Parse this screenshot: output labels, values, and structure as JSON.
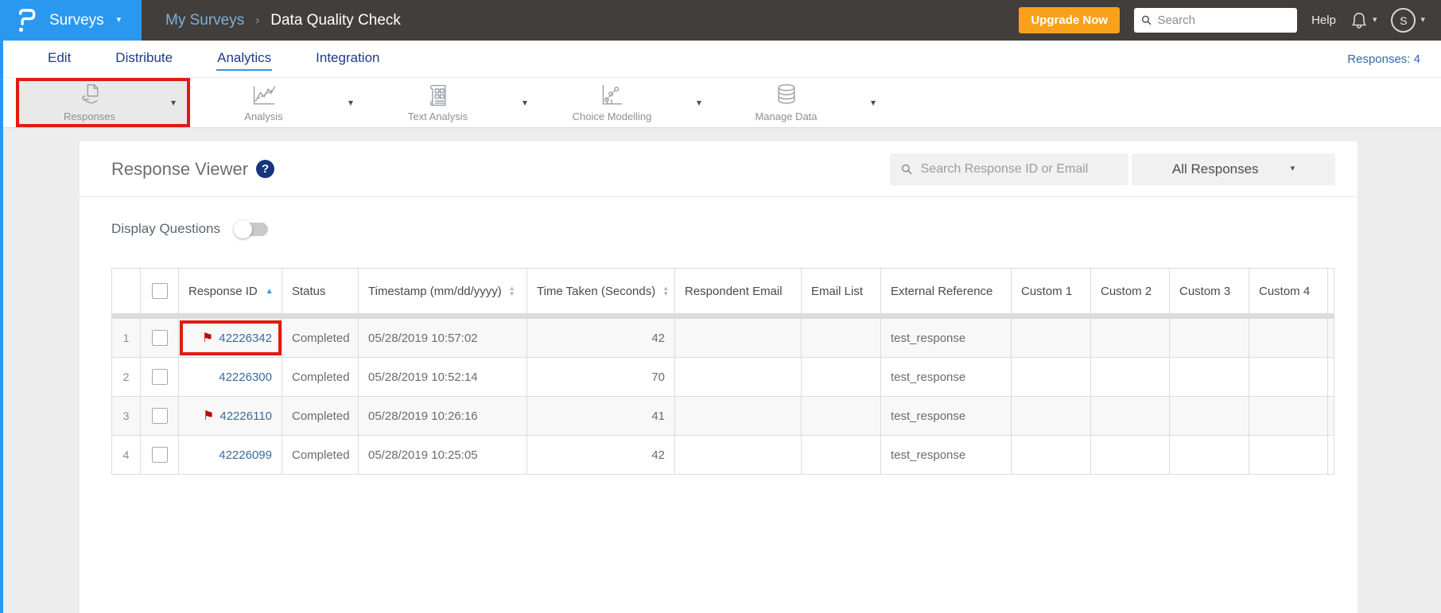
{
  "topbar": {
    "product": "Surveys",
    "breadcrumb": {
      "parent": "My Surveys",
      "separator": "›",
      "current": "Data Quality Check"
    },
    "upgrade_label": "Upgrade Now",
    "search_placeholder": "Search",
    "help_label": "Help",
    "avatar_initial": "S"
  },
  "nav": {
    "tabs": [
      "Edit",
      "Distribute",
      "Analytics",
      "Integration"
    ],
    "active_tab": "Analytics",
    "responses_count_label": "Responses: 4"
  },
  "toolbar": {
    "items": [
      {
        "label": "Responses",
        "icon": "hand-document-icon",
        "selected": true,
        "annotated": true
      },
      {
        "label": "Analysis",
        "icon": "line-chart-icon",
        "selected": false,
        "annotated": false
      },
      {
        "label": "Text Analysis",
        "icon": "newspaper-icon",
        "selected": false,
        "annotated": false
      },
      {
        "label": "Choice Modelling",
        "icon": "scatter-chart-icon",
        "selected": false,
        "annotated": false
      },
      {
        "label": "Manage Data",
        "icon": "database-icon",
        "selected": false,
        "annotated": false
      }
    ]
  },
  "panel": {
    "title": "Response Viewer",
    "help_glyph": "?",
    "search_placeholder": "Search Response ID or Email",
    "filter_value": "All Responses",
    "display_questions_label": "Display Questions",
    "display_questions_state": "off"
  },
  "table": {
    "columns": [
      {
        "label": "",
        "type": "row-number"
      },
      {
        "label": "",
        "type": "checkbox"
      },
      {
        "label": "Response ID",
        "sort": "asc"
      },
      {
        "label": "Status",
        "sort": "none"
      },
      {
        "label": "Timestamp (mm/dd/yyyy)",
        "sort": "both"
      },
      {
        "label": "Time Taken (Seconds)",
        "sort": "both"
      },
      {
        "label": "Respondent Email",
        "sort": "none"
      },
      {
        "label": "Email List",
        "sort": "none"
      },
      {
        "label": "External Reference",
        "sort": "none"
      },
      {
        "label": "Custom 1",
        "sort": "none"
      },
      {
        "label": "Custom 2",
        "sort": "none"
      },
      {
        "label": "Custom 3",
        "sort": "none"
      },
      {
        "label": "Custom 4",
        "sort": "none"
      }
    ],
    "rows": [
      {
        "num": "1",
        "id": "42226342",
        "flagged": true,
        "annotated": true,
        "status": "Completed",
        "timestamp": "05/28/2019 10:57:02",
        "time_taken": "42",
        "respondent_email": "",
        "email_list": "",
        "external_reference": "test_response",
        "custom1": "",
        "custom2": "",
        "custom3": "",
        "custom4": ""
      },
      {
        "num": "2",
        "id": "42226300",
        "flagged": false,
        "annotated": false,
        "status": "Completed",
        "timestamp": "05/28/2019 10:52:14",
        "time_taken": "70",
        "respondent_email": "",
        "email_list": "",
        "external_reference": "test_response",
        "custom1": "",
        "custom2": "",
        "custom3": "",
        "custom4": ""
      },
      {
        "num": "3",
        "id": "42226110",
        "flagged": true,
        "annotated": false,
        "status": "Completed",
        "timestamp": "05/28/2019 10:26:16",
        "time_taken": "41",
        "respondent_email": "",
        "email_list": "",
        "external_reference": "test_response",
        "custom1": "",
        "custom2": "",
        "custom3": "",
        "custom4": ""
      },
      {
        "num": "4",
        "id": "42226099",
        "flagged": false,
        "annotated": false,
        "status": "Completed",
        "timestamp": "05/28/2019 10:25:05",
        "time_taken": "42",
        "respondent_email": "",
        "email_list": "",
        "external_reference": "test_response",
        "custom1": "",
        "custom2": "",
        "custom3": "",
        "custom4": ""
      }
    ]
  },
  "icons": {
    "caret_down": "▾",
    "sort_up": "▲",
    "sort_down": "▼",
    "flag": "⚑"
  },
  "colors": {
    "brand_blue": "#2b98f0",
    "topbar_dark": "#413e3c",
    "upgrade_orange": "#f9a11b",
    "tab_navy": "#1d3c85",
    "link_blue": "#3a6b9b",
    "flag_red": "#b50f0b",
    "annotation_red": "#e11b12",
    "help_badge_navy": "#17357d"
  }
}
